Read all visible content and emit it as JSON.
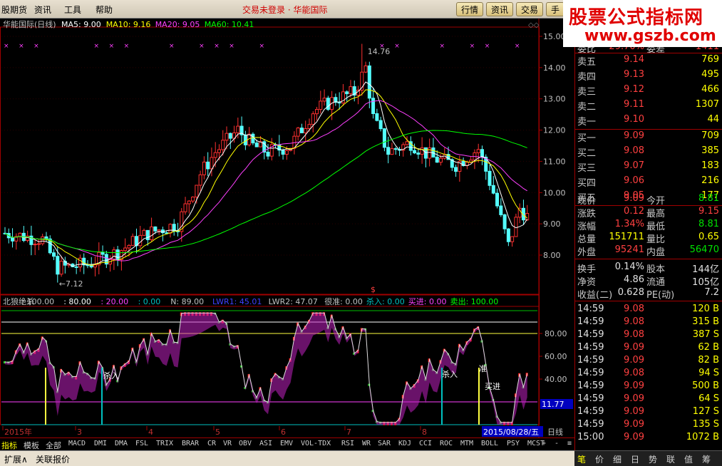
{
  "menu": [
    "股期货",
    "资讯",
    "工具",
    "帮助"
  ],
  "center_title": "交易未登录 · 华能国际",
  "toolbar": [
    "行情",
    "资讯",
    "交易",
    "手"
  ],
  "watermark": {
    "title": "股票公式指标网",
    "url": "www.gszb.com"
  },
  "chart": {
    "header_name": "华能国际(日线)",
    "ma": [
      {
        "label": "MA5: 9.00",
        "color": "#ffffff"
      },
      {
        "label": "MA10: 9.16",
        "color": "#ffff00"
      },
      {
        "label": "MA20: 9.05",
        "color": "#ff40ff"
      },
      {
        "label": "MA60: 10.41",
        "color": "#00ff00"
      }
    ],
    "price_axis": [
      "15.00",
      "14.00",
      "13.00",
      "12.00",
      "11.00",
      "10.00",
      "9.00",
      "8.00"
    ],
    "high_label": "14.76",
    "low_label": "7.12",
    "dollar_mark": "$",
    "indicator_header": [
      {
        "t": "北狼绝杀",
        "c": "#c0c0c0"
      },
      {
        "t": ": 100.00",
        "c": "#c0c0c0"
      },
      {
        "t": ": 80.00",
        "c": "#ffffff"
      },
      {
        "t": ": 20.00",
        "c": "#ff40ff"
      },
      {
        "t": ": 0.00",
        "c": "#00c0c0"
      },
      {
        "t": "N: 89.00",
        "c": "#c0c0c0"
      },
      {
        "t": "LWR1: 45.01",
        "c": "#4040ff"
      },
      {
        "t": "LWR2: 47.07",
        "c": "#c0c0c0"
      },
      {
        "t": "很准: 0.00",
        "c": "#c0c0c0"
      },
      {
        "t": "杀入: 0.00",
        "c": "#00c0c0"
      },
      {
        "t": "买进: 0.00",
        "c": "#ff40ff"
      },
      {
        "t": "卖出: 100.00",
        "c": "#00ff00"
      }
    ],
    "ind_axis": [
      "80.00",
      "60.00",
      "40.00"
    ],
    "ind_labels": [
      "杀入",
      "杀入",
      "准",
      "买进"
    ],
    "ind_value": "11.77",
    "date_axis": [
      "2015年",
      "3",
      "4",
      "5",
      "6",
      "7",
      "8"
    ],
    "date_box": "2015/08/28/五",
    "period": "日线"
  },
  "indicator_tabs_left": [
    "指标",
    "模板",
    "全部"
  ],
  "indicator_tabs": [
    "MACD",
    "DMI",
    "DMA",
    "FSL",
    "TRIX",
    "BRAR",
    "CR",
    "VR",
    "OBV",
    "ASI",
    "EMV",
    "VOL-TDX",
    "RSI",
    "WR",
    "SAR",
    "KDJ",
    "CCI",
    "ROC",
    "MTM",
    "BOLL",
    "PSY",
    "MCST"
  ],
  "nav_btns": [
    "+",
    "-",
    "≡"
  ],
  "status_items": [
    "扩展∧",
    "关联报价"
  ],
  "panel": {
    "weibi": {
      "l": "委比",
      "v": "-29.70%",
      "k": "委差",
      "r": "-1411"
    },
    "sells": [
      {
        "l": "卖五",
        "p": "9.14",
        "q": "769"
      },
      {
        "l": "卖四",
        "p": "9.13",
        "q": "495"
      },
      {
        "l": "卖三",
        "p": "9.12",
        "q": "466"
      },
      {
        "l": "卖二",
        "p": "9.11",
        "q": "1307"
      },
      {
        "l": "卖一",
        "p": "9.10",
        "q": "44"
      }
    ],
    "buys": [
      {
        "l": "买一",
        "p": "9.09",
        "q": "709"
      },
      {
        "l": "买二",
        "p": "9.08",
        "q": "385"
      },
      {
        "l": "买三",
        "p": "9.07",
        "q": "183"
      },
      {
        "l": "买四",
        "p": "9.06",
        "q": "216"
      },
      {
        "l": "买五",
        "p": "9.05",
        "q": "177"
      }
    ],
    "quote": [
      {
        "l": "现价",
        "v": "9.09",
        "vc": "red",
        "k": "今开",
        "r": "8.81",
        "rc": "grn"
      },
      {
        "l": "涨跌",
        "v": "0.12",
        "vc": "red",
        "k": "最高",
        "r": "9.15",
        "rc": "red"
      },
      {
        "l": "涨幅",
        "v": "1.34%",
        "vc": "red",
        "k": "最低",
        "r": "8.81",
        "rc": "grn"
      },
      {
        "l": "总量",
        "v": "151711",
        "vc": "yel",
        "k": "量比",
        "r": "0.65",
        "rc": "yel"
      },
      {
        "l": "外盘",
        "v": "95241",
        "vc": "red",
        "k": "内盘",
        "r": "56470",
        "rc": "grn"
      }
    ],
    "stats": [
      {
        "l": "换手",
        "v": "0.14%",
        "k": "股本",
        "r": "144亿"
      },
      {
        "l": "净资",
        "v": "4.86",
        "k": "流通",
        "r": "105亿"
      },
      {
        "l": "收益(二)",
        "v": "0.628",
        "k": "PE(动)",
        "r": "7.2"
      }
    ],
    "ticks": [
      {
        "t": "14:59",
        "p": "9.08",
        "q": "120",
        "s": "B"
      },
      {
        "t": "14:59",
        "p": "9.08",
        "q": "315",
        "s": "B"
      },
      {
        "t": "14:59",
        "p": "9.08",
        "q": "387",
        "s": "S"
      },
      {
        "t": "14:59",
        "p": "9.09",
        "q": "62",
        "s": "B"
      },
      {
        "t": "14:59",
        "p": "9.09",
        "q": "82",
        "s": "B"
      },
      {
        "t": "14:59",
        "p": "9.08",
        "q": "94",
        "s": "S"
      },
      {
        "t": "14:59",
        "p": "9.09",
        "q": "500",
        "s": "B"
      },
      {
        "t": "14:59",
        "p": "9.09",
        "q": "64",
        "s": "S"
      },
      {
        "t": "14:59",
        "p": "9.09",
        "q": "127",
        "s": "S"
      },
      {
        "t": "14:59",
        "p": "9.09",
        "q": "135",
        "s": "S"
      },
      {
        "t": "15:00",
        "p": "9.09",
        "q": "1072",
        "s": "B"
      }
    ]
  },
  "right_tabs": [
    "笔",
    "价",
    "细",
    "日",
    "势",
    "联",
    "值",
    "筹"
  ],
  "colors": {
    "up": "#ff3030",
    "down": "#54ffff",
    "ma5": "#ffffff",
    "ma10": "#ffff00",
    "ma20": "#ff40ff",
    "ma60": "#00ff00",
    "grid": "#a00000"
  }
}
